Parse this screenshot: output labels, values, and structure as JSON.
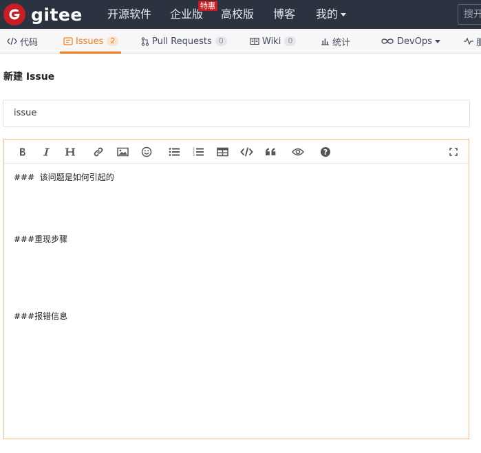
{
  "nav": {
    "brand": "gitee",
    "links": [
      "开源软件",
      "企业版",
      "高校版",
      "博客",
      "我的"
    ],
    "badge": "特惠",
    "search_placeholder": "搜开"
  },
  "tabs": [
    {
      "label": "代码"
    },
    {
      "label": "Issues",
      "count": "2"
    },
    {
      "label": "Pull Requests",
      "count": "0"
    },
    {
      "label": "Wiki",
      "count": "0"
    },
    {
      "label": "统计"
    },
    {
      "label": "DevOps"
    },
    {
      "label": "服"
    }
  ],
  "page": {
    "title": "新建 Issue",
    "issue_title_value": "issue"
  },
  "editor": {
    "toolbar": [
      "bold-icon",
      "italic-icon",
      "heading-icon",
      "link-icon",
      "image-icon",
      "emoji-icon",
      "unordered-list-icon",
      "ordered-list-icon",
      "table-icon",
      "code-icon",
      "quote-icon",
      "preview-icon",
      "help-icon",
      "fullscreen-icon"
    ],
    "lines": [
      "###  该问题是如何引起的",
      "###重现步骤",
      "###报错信息"
    ]
  },
  "colors": {
    "nav_bg": "#2c3340",
    "accent": "#f37b1d",
    "brand_red": "#c71d23"
  }
}
